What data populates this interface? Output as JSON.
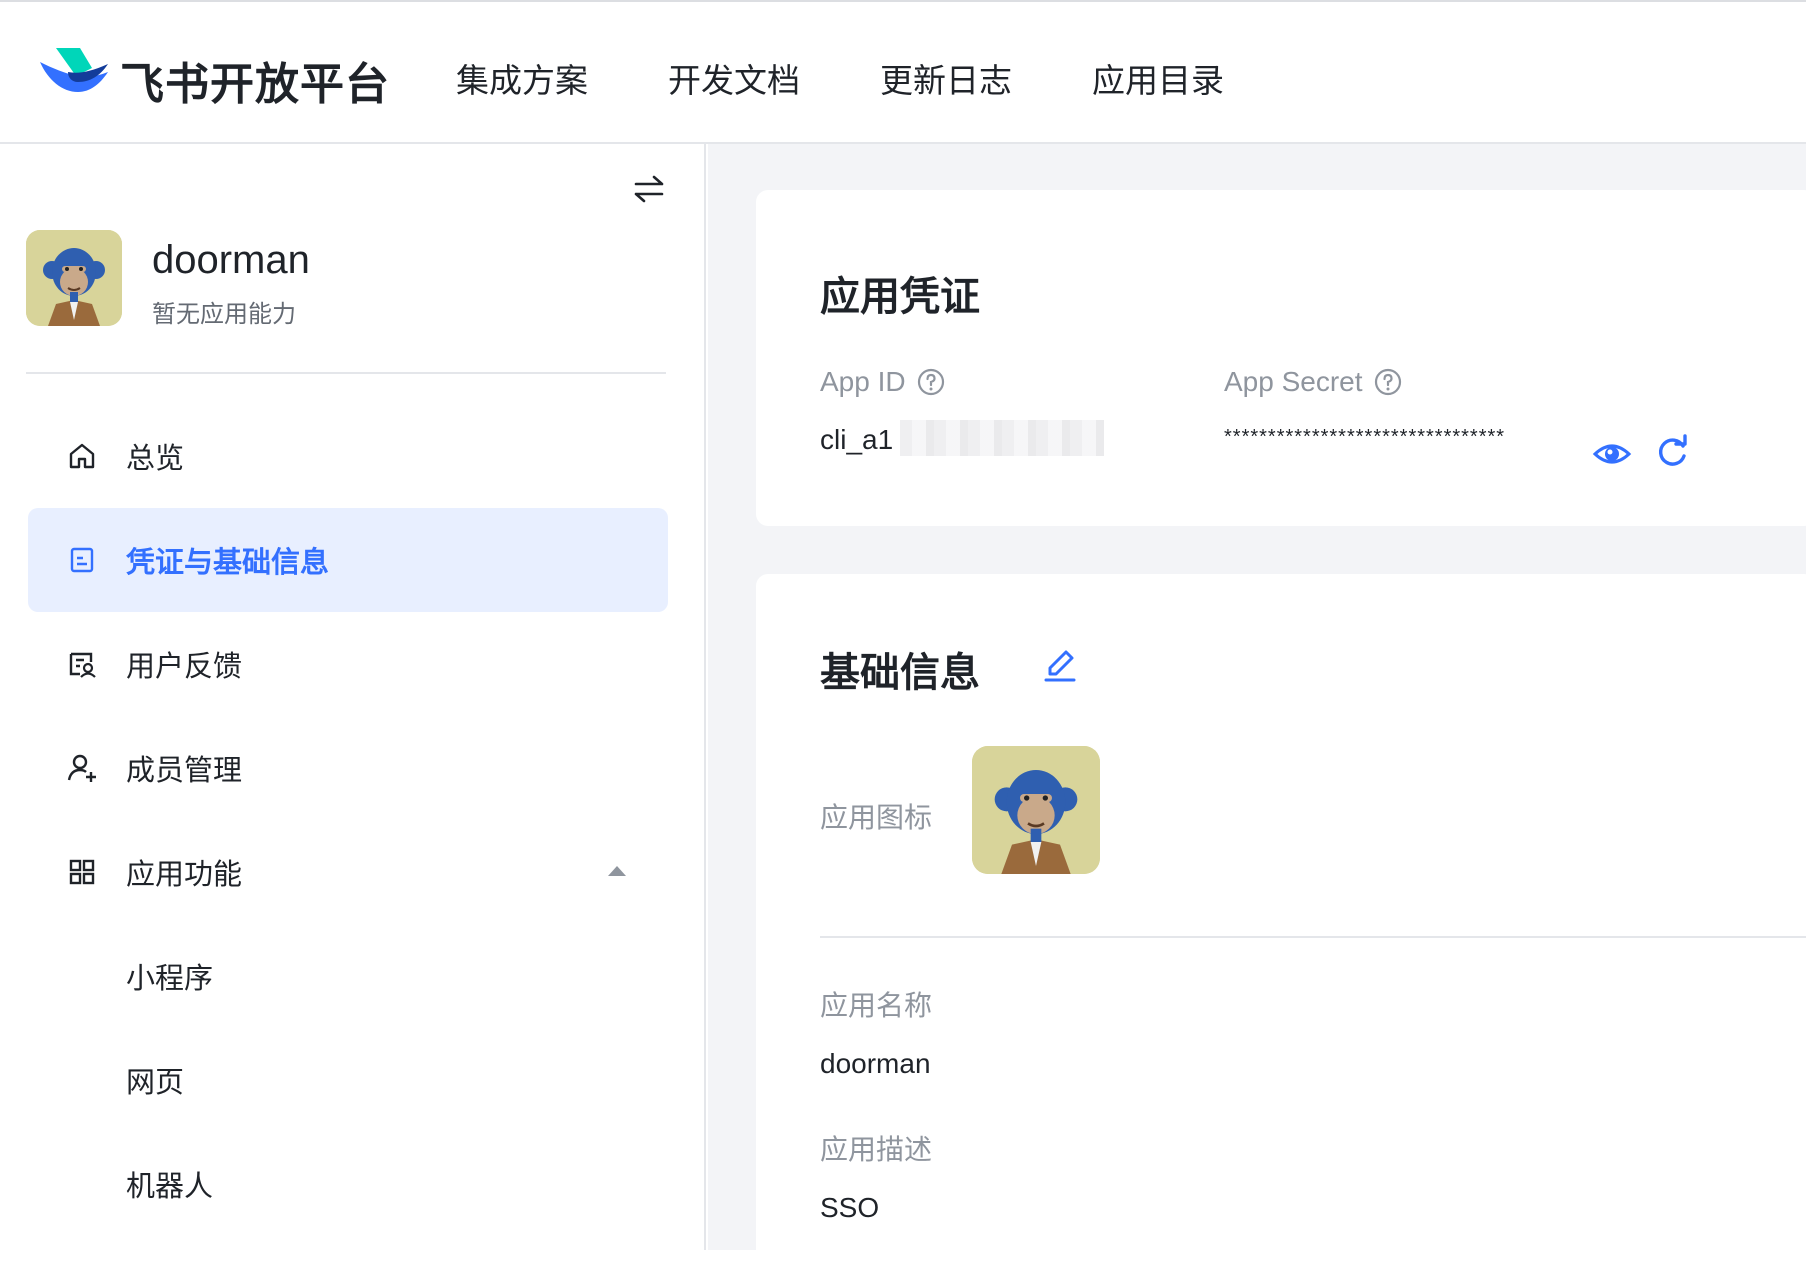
{
  "header": {
    "brand": "飞书开放平台",
    "nav": [
      "集成方案",
      "开发文档",
      "更新日志",
      "应用目录"
    ]
  },
  "sidebar": {
    "app_name": "doorman",
    "app_capability": "暂无应用能力",
    "items": [
      {
        "label": "总览",
        "icon": "home-icon"
      },
      {
        "label": "凭证与基础信息",
        "icon": "document-icon",
        "active": true
      },
      {
        "label": "用户反馈",
        "icon": "feedback-icon"
      },
      {
        "label": "成员管理",
        "icon": "add-user-icon"
      },
      {
        "label": "应用功能",
        "icon": "grid-icon",
        "expanded": true
      },
      {
        "label": "小程序"
      },
      {
        "label": "网页"
      },
      {
        "label": "机器人"
      }
    ]
  },
  "credentials": {
    "title": "应用凭证",
    "app_id_label": "App ID",
    "app_id_value": "cli_a1",
    "app_secret_label": "App Secret",
    "app_secret_value": "********************************"
  },
  "basic_info": {
    "title": "基础信息",
    "icon_label": "应用图标",
    "name_label": "应用名称",
    "name_value": "doorman",
    "desc_label": "应用描述",
    "desc_value": "SSO"
  },
  "colors": {
    "accent": "#3370ff",
    "active_bg": "#e8efff",
    "main_bg": "#f3f4f7",
    "muted_text": "#8f959e"
  }
}
